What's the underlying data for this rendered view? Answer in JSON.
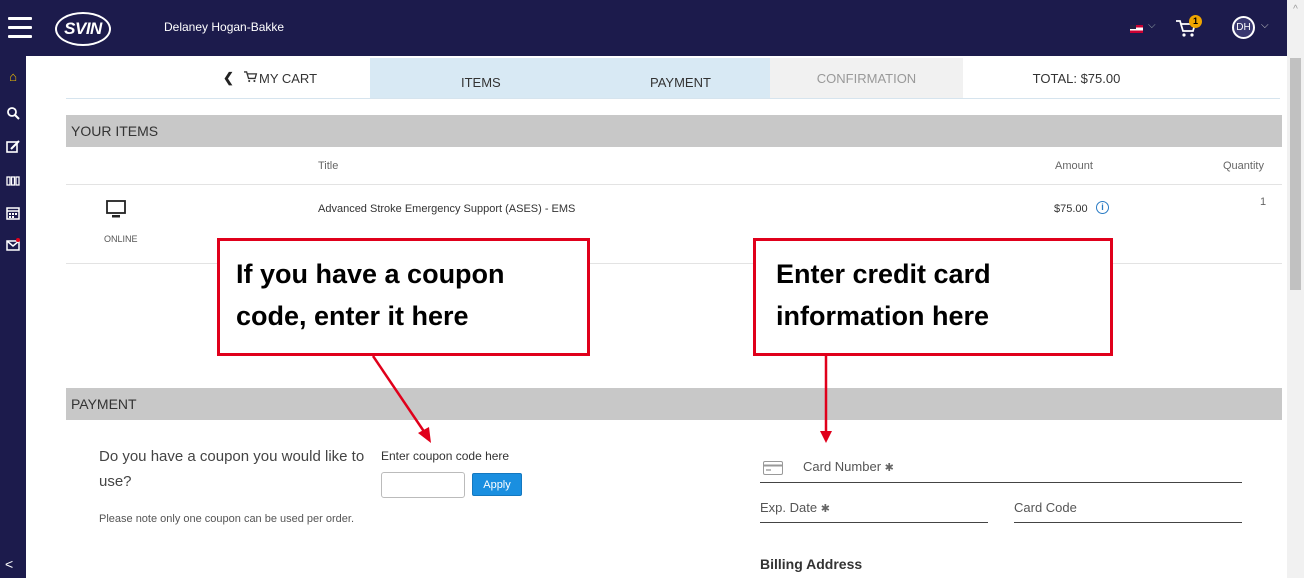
{
  "header": {
    "logo_text": "SVIN",
    "user_name": "Delaney Hogan-Bakke",
    "cart_count": "1",
    "avatar_initials": "DH"
  },
  "steps": {
    "cart": "MY CART",
    "items": "ITEMS",
    "payment": "PAYMENT",
    "confirmation": "CONFIRMATION",
    "total": "TOTAL: $75.00"
  },
  "items_section": {
    "header": "YOUR ITEMS",
    "columns": {
      "title": "Title",
      "amount": "Amount",
      "quantity": "Quantity"
    },
    "rows": [
      {
        "type": "ONLINE",
        "title": "Advanced Stroke Emergency Support (ASES) - EMS",
        "amount": "$75.00",
        "quantity": "1"
      }
    ]
  },
  "callouts": {
    "coupon_line1": "If you have a coupon",
    "coupon_line2": "code, enter it here",
    "cc_line1": "Enter credit card",
    "cc_line2": "information here"
  },
  "payment_section": {
    "header": "PAYMENT",
    "coupon_question": "Do you have a coupon you would like to use?",
    "coupon_note": "Please note only one coupon can be used per order.",
    "coupon_label": "Enter coupon code here",
    "coupon_value": "",
    "apply_label": "Apply",
    "card_number_label": "Card Number",
    "exp_date_label": "Exp. Date",
    "card_code_label": "Card Code",
    "required_mark": "✱",
    "billing_label": "Billing Address"
  },
  "colors": {
    "nav_bg": "#1c1b4c",
    "accent_blue": "#1a8fe0",
    "callout_red": "#e0001b",
    "header_gray": "#c8c8c8"
  }
}
